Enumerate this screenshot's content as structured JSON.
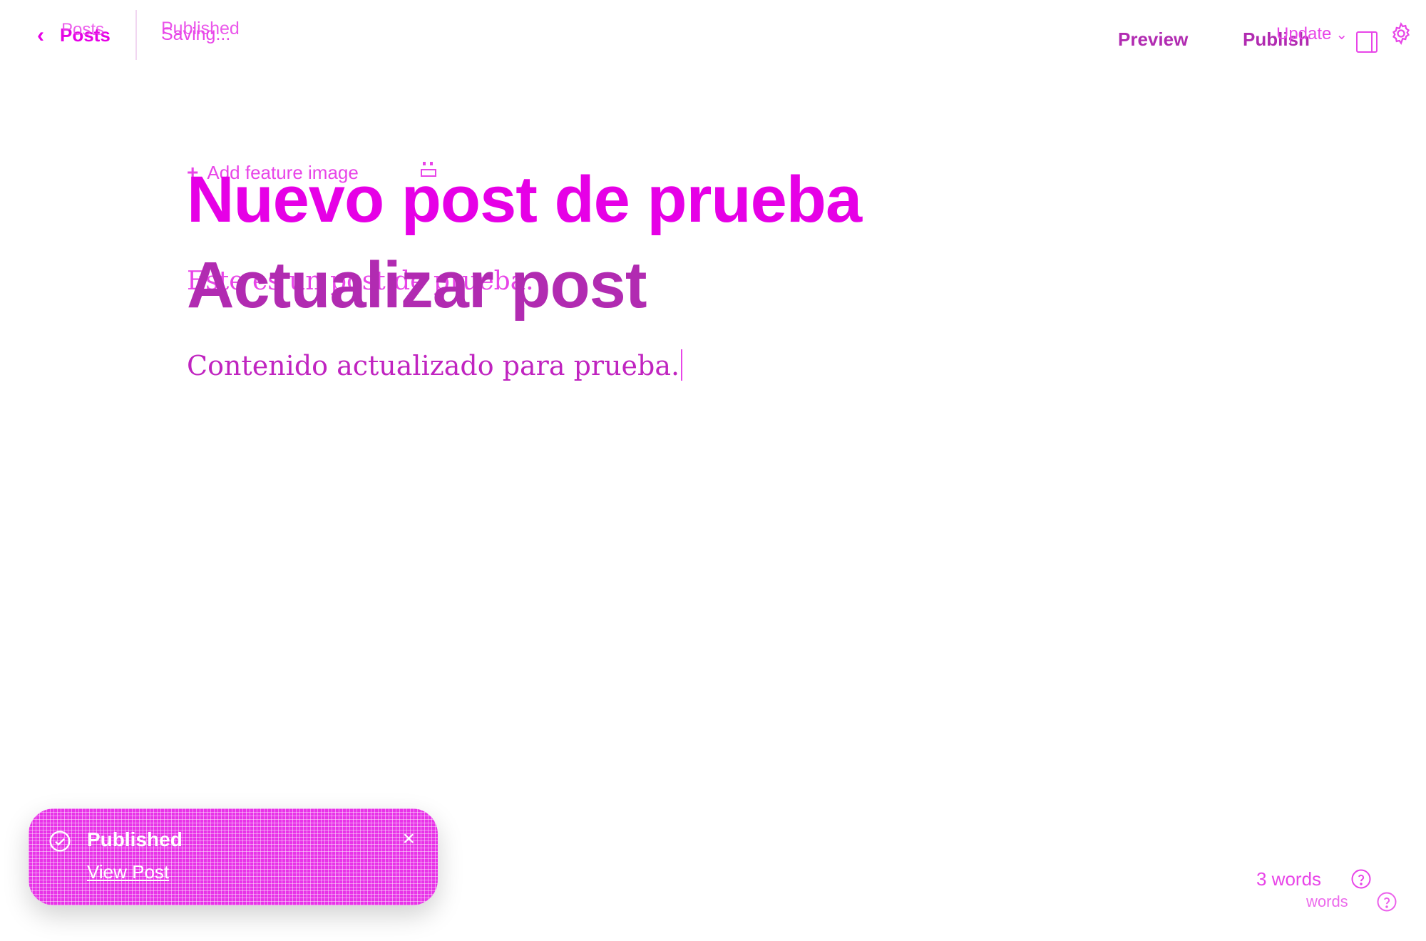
{
  "header": {
    "back_label": "Posts",
    "back_label_ghost": "Posts",
    "status_label": "Saving...",
    "status_label_ghost": "Published",
    "preview_label": "Preview",
    "publish_label": "Publish",
    "update_label": "Update"
  },
  "editor": {
    "feature_image_label": "Add feature image",
    "title": "Nuevo post de prueba",
    "title_overlay": "Actualizar post",
    "excerpt_ghost": "Este es un post de prueba.",
    "body": "Contenido actualizado para prueba."
  },
  "toast": {
    "title": "Published",
    "link_label": "View Post"
  },
  "footer": {
    "word_count": "3 words",
    "word_count_ghost": "words"
  },
  "colors": {
    "accent": "#e845e8",
    "toast_bg": "#e833e8",
    "title_overlay": "#b12bb1"
  }
}
